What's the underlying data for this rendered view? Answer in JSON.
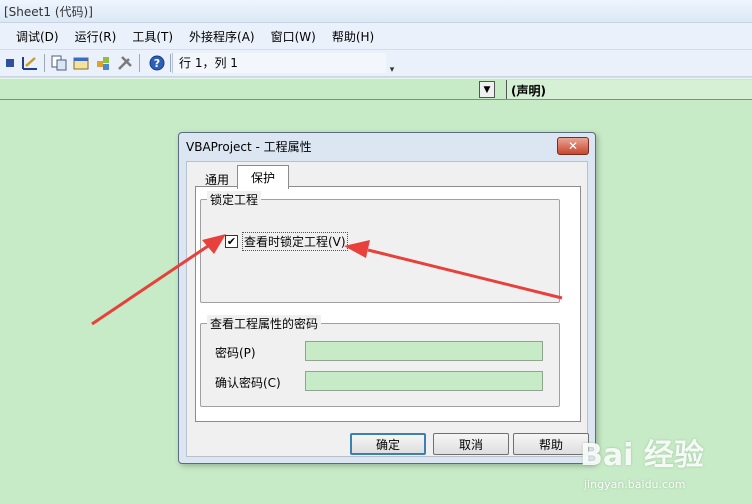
{
  "window": {
    "title": "[Sheet1 (代码)]"
  },
  "menubar": {
    "items": [
      {
        "label": "调试(D)"
      },
      {
        "label": "运行(R)"
      },
      {
        "label": "工具(T)"
      },
      {
        "label": "外接程序(A)"
      },
      {
        "label": "窗口(W)"
      },
      {
        "label": "帮助(H)"
      }
    ]
  },
  "toolbar": {
    "icons": [
      "stop-icon",
      "design-mode-icon",
      "project-explorer-icon",
      "properties-window-icon",
      "object-browser-icon",
      "toolbox-icon",
      "help-icon"
    ],
    "position_text": "行 1，列 1"
  },
  "codebar": {
    "procedure_value": "(声明)"
  },
  "dialog": {
    "title": "VBAProject - 工程属性",
    "close_glyph": "✕",
    "tabs": [
      {
        "label": "通用"
      },
      {
        "label": "保护",
        "selected": true
      }
    ],
    "lock_group": {
      "legend": "锁定工程",
      "checkbox_label": "查看时锁定工程(V)",
      "checked": true
    },
    "password_group": {
      "legend": "查看工程属性的密码",
      "password_label": "密码(P)",
      "confirm_label": "确认密码(C)",
      "password_value": "",
      "confirm_value": ""
    },
    "buttons": {
      "ok": "确定",
      "cancel": "取消",
      "help": "帮助"
    }
  },
  "annotation": {
    "arrow_color": "#e8403a"
  },
  "watermark": {
    "logo": "Bai 经验",
    "url": "jingyan.baidu.com"
  }
}
